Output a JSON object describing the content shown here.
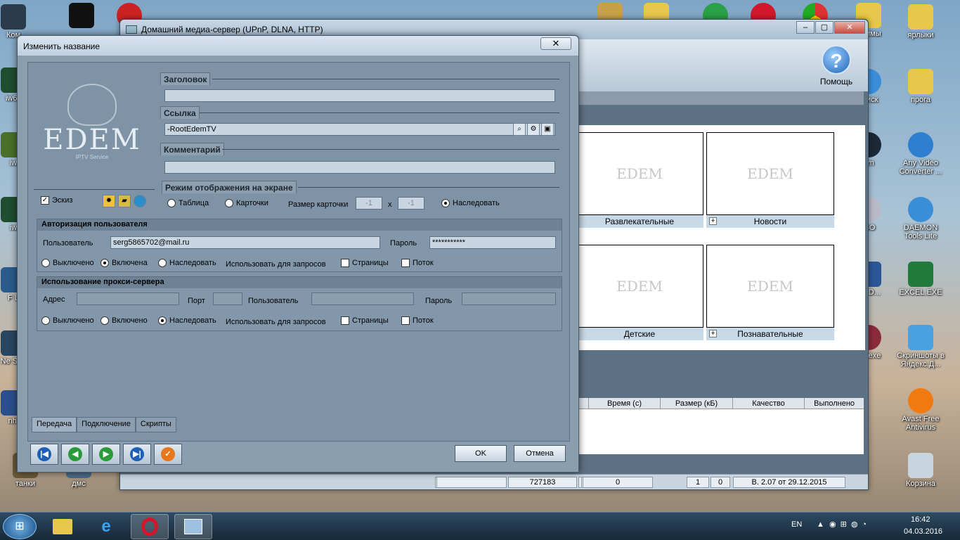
{
  "desktop": {
    "icons_right": [
      {
        "label": "ярлыки"
      },
      {
        "label": "прога"
      },
      {
        "label": "Any Video Converter ..."
      },
      {
        "label": "DAEMON Tools Lite"
      },
      {
        "label": "EXCEL.EXE"
      },
      {
        "label": "Скриншоты в Яндекс.Д..."
      },
      {
        "label": "Avast Free Antivirus"
      },
      {
        "label": "Корзина"
      }
    ],
    "icons_bottom": [
      {
        "label": "танки"
      },
      {
        "label": "дмс"
      }
    ],
    "partial_labels": [
      "Ком",
      "iw6s",
      "iw",
      "iw",
      "F L",
      "Ne Spe",
      "nhl",
      "раммы",
      ".Диск",
      "am",
      "ISO",
      "ORD...",
      "ilenexe"
    ]
  },
  "main_window": {
    "title": "Домашний медиа-сервер (UPnP, DLNA, HTTP)",
    "help_label": "Помощь",
    "cards": [
      {
        "caption": "Развлекательные",
        "logo": "EDEM"
      },
      {
        "caption": "Новости",
        "logo": "EDEM"
      },
      {
        "caption": "Детские",
        "logo": "EDEM"
      },
      {
        "caption": "Познавательные",
        "logo": "EDEM"
      }
    ],
    "table_columns": [
      "Время (с)",
      "Размер (кБ)",
      "Качество",
      "Выполнено"
    ],
    "status": {
      "count": "727183",
      "v1": "0",
      "v2": "0",
      "v3": "1",
      "v4": "0",
      "version": "В. 2.07 от 29.12.2015"
    }
  },
  "dialog": {
    "title": "Изменить название",
    "close": "✕",
    "logo_text": "EDEM",
    "logo_sub": "IPTV Service",
    "preview_checkbox": "Эскиз",
    "header_label": "Заголовок",
    "header_value": "",
    "link_label": "Ссылка",
    "link_value": "-RootEdemTV",
    "comment_label": "Комментарий",
    "comment_value": "",
    "display_mode_label": "Режим отображения на экране",
    "display_modes": {
      "table": "Таблица",
      "cards": "Карточки",
      "inherit": "Наследовать"
    },
    "card_size_label": "Размер карточки",
    "card_w": "-1",
    "card_x": "x",
    "card_h": "-1",
    "auth": {
      "title": "Авторизация пользователя",
      "user_label": "Пользователь",
      "user_value": "serg5865702@mail.ru",
      "password_label": "Пароль",
      "password_value": "***********",
      "off": "Выключено",
      "on": "Включена",
      "inherit": "Наследовать",
      "use_for": "Использовать для запросов",
      "pages": "Страницы",
      "stream": "Поток"
    },
    "proxy": {
      "title": "Использование прокси-сервера",
      "address_label": "Адрес",
      "port_label": "Порт",
      "user_label": "Пользователь",
      "password_label": "Пароль",
      "off": "Выключено",
      "on": "Включено",
      "inherit": "Наследовать",
      "use_for": "Использовать для запросов",
      "pages": "Страницы",
      "stream": "Поток"
    },
    "tabs": [
      "Передача",
      "Подключение",
      "Скрипты"
    ],
    "ok": "OK",
    "cancel": "Отмена"
  },
  "taskbar": {
    "lang": "EN",
    "time": "16:42",
    "date": "04.03.2016"
  },
  "colors": {
    "dialog_bg": "#8a9eb0",
    "inner_bg": "#7f93a6",
    "field_bg": "#c8d6e2",
    "taskbar": "#1c3146"
  }
}
